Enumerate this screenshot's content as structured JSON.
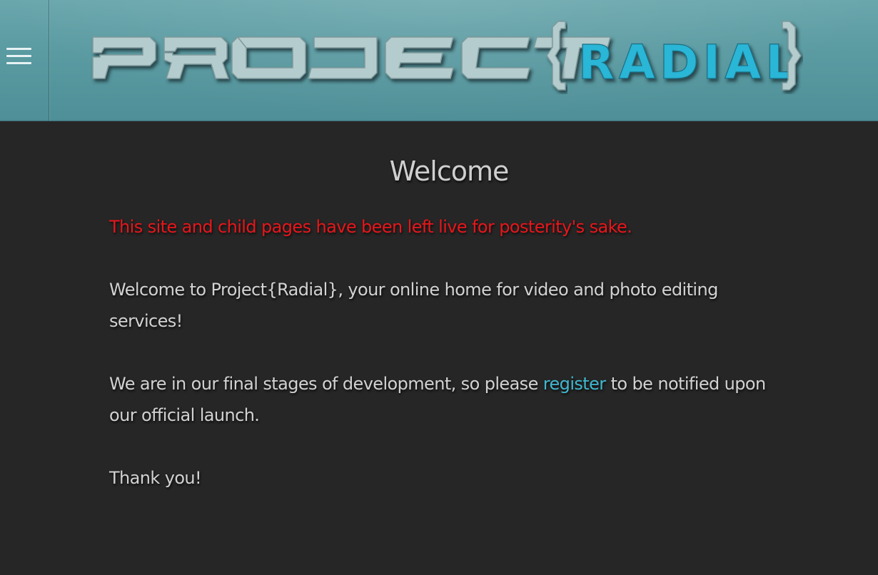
{
  "header": {
    "logo": {
      "text_main": "PROJECT",
      "text_accent": "RADIAL",
      "brace_open": "{",
      "brace_close": "}",
      "alt": "PROJECT{RADIAL}"
    },
    "menu_icon": "hamburger-menu-icon"
  },
  "colors": {
    "header_bg": "#5b9ba2",
    "page_bg": "#262626",
    "logo_main": "#b4cccd",
    "logo_accent": "#29b6d6",
    "notice": "#e8161b",
    "link": "#3fb8cf",
    "text": "#d2d2d2"
  },
  "main": {
    "title": "Welcome",
    "notice": "This site and child pages have been left live for posterity's sake.",
    "intro": "Welcome to Project{Radial}, your online home for video and photo editing services!",
    "dev_before": "We are in our final stages of development, so please ",
    "dev_link": "register",
    "dev_after": " to be notified upon our official launch.",
    "thanks": "Thank you!"
  }
}
